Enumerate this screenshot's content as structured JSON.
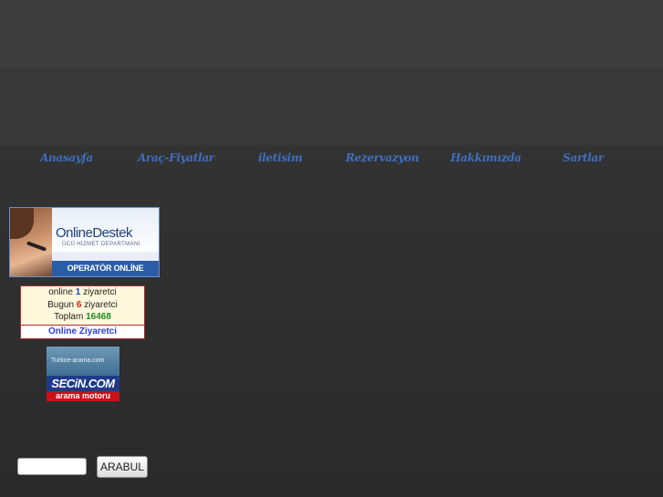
{
  "nav": {
    "items": [
      {
        "label": "Anasayfa"
      },
      {
        "label": "Araç-Fiyatlar"
      },
      {
        "label": "iletisim"
      },
      {
        "label": "Rezervazyon"
      },
      {
        "label": "Hakkımızda"
      },
      {
        "label": "Sartlar"
      }
    ]
  },
  "support_banner": {
    "title": "OnlineDestek",
    "subtitle": "ÜCÜ HİZMET DEPARTMANI",
    "status": "OPERATÖR ONLİNE"
  },
  "counter": {
    "online_prefix": "online",
    "online_count": "1",
    "online_suffix": "ziyaretci",
    "today_prefix": "Bugun",
    "today_count": "6",
    "today_suffix": "ziyaretci",
    "total_prefix": "Toplam",
    "total_count": "16468",
    "link_label": "Online Ziyaretci"
  },
  "secin_banner": {
    "url_text": "Turkce-arama.com",
    "brand": "SECiN.COM",
    "tagline": "arama motoru"
  },
  "search": {
    "value": "",
    "button_label": "ARABUL"
  },
  "colors": {
    "nav_text": "#3f6fbf",
    "counter_border": "#b02a2a"
  }
}
